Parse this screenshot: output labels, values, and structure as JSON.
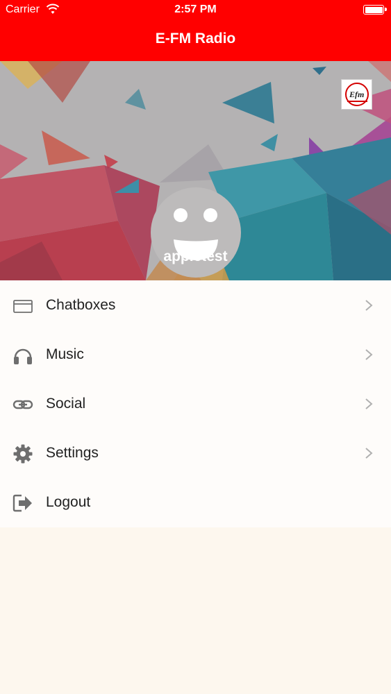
{
  "status_bar": {
    "carrier": "Carrier",
    "time": "2:57 PM"
  },
  "nav": {
    "title": "E-FM Radio"
  },
  "profile": {
    "username": "appletest",
    "logo_text": "Efm"
  },
  "menu": {
    "items": [
      {
        "label": "Chatboxes",
        "icon": "chatbox-icon",
        "has_chevron": true
      },
      {
        "label": "Music",
        "icon": "headphones-icon",
        "has_chevron": true
      },
      {
        "label": "Social",
        "icon": "link-icon",
        "has_chevron": true
      },
      {
        "label": "Settings",
        "icon": "gear-icon",
        "has_chevron": true
      },
      {
        "label": "Logout",
        "icon": "logout-icon",
        "has_chevron": false
      }
    ]
  },
  "colors": {
    "brand": "#ff0000",
    "menu_background": "#fefcfa",
    "icon_gray": "#6e6e6e"
  }
}
